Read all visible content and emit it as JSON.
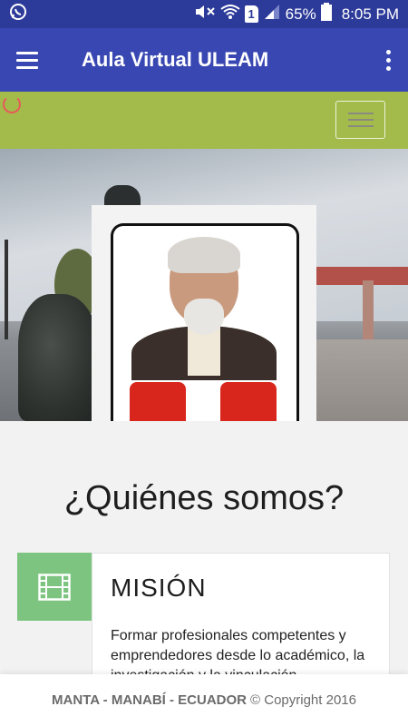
{
  "status_bar": {
    "battery": "65%",
    "time": "8:05 PM",
    "sim": "1",
    "icons": [
      "whatsapp-icon",
      "mute-icon",
      "wifi-icon",
      "sim-icon",
      "signal-icon",
      "battery-icon"
    ]
  },
  "app_bar": {
    "title": "Aula Virtual ULEAM",
    "icons": [
      "menu-icon",
      "overflow-menu-icon"
    ]
  },
  "content": {
    "heading": "¿Quiénes somos?",
    "mission": {
      "title": "MISIÓN",
      "text": "Formar profesionales competentes y emprendedores desde lo académico, la investigación y la vinculación,"
    }
  },
  "footer": {
    "location": "MANTA - MANABÍ - ECUADOR",
    "copyright": "© Copyright 2016"
  },
  "colors": {
    "status_bar": "#2c3a99",
    "app_bar": "#3847b2",
    "green_bar": "#a3bb4a",
    "icon_box": "#7cc47f"
  }
}
